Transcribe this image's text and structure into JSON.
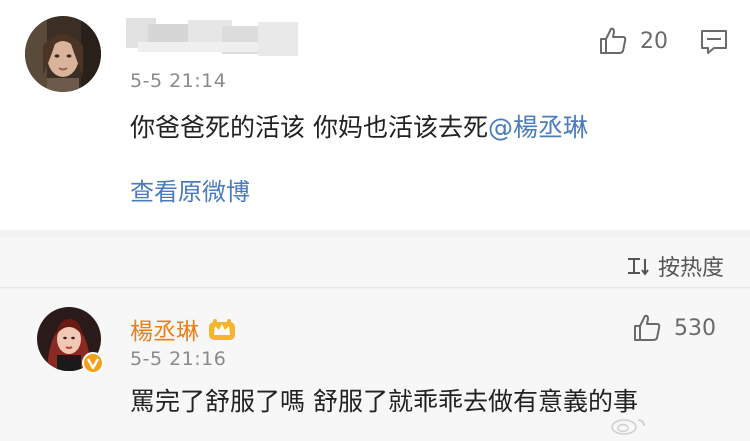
{
  "comment_main": {
    "time": "5-5 21:14",
    "text": "你爸爸死的活该   你妈也活该去死",
    "mention": "@楊丞琳",
    "like_count": "20",
    "view_original_label": "查看原微博"
  },
  "sort_bar": {
    "label": "按热度"
  },
  "reply": {
    "username": "楊丞琳",
    "time": "5-5 21:16",
    "text": "罵完了舒服了嗎 舒服了就乖乖去做有意義的事",
    "like_count": "530"
  },
  "colors": {
    "link": "#4a7bbd",
    "vip_name": "#e5801f",
    "time": "#8a8a8a"
  }
}
